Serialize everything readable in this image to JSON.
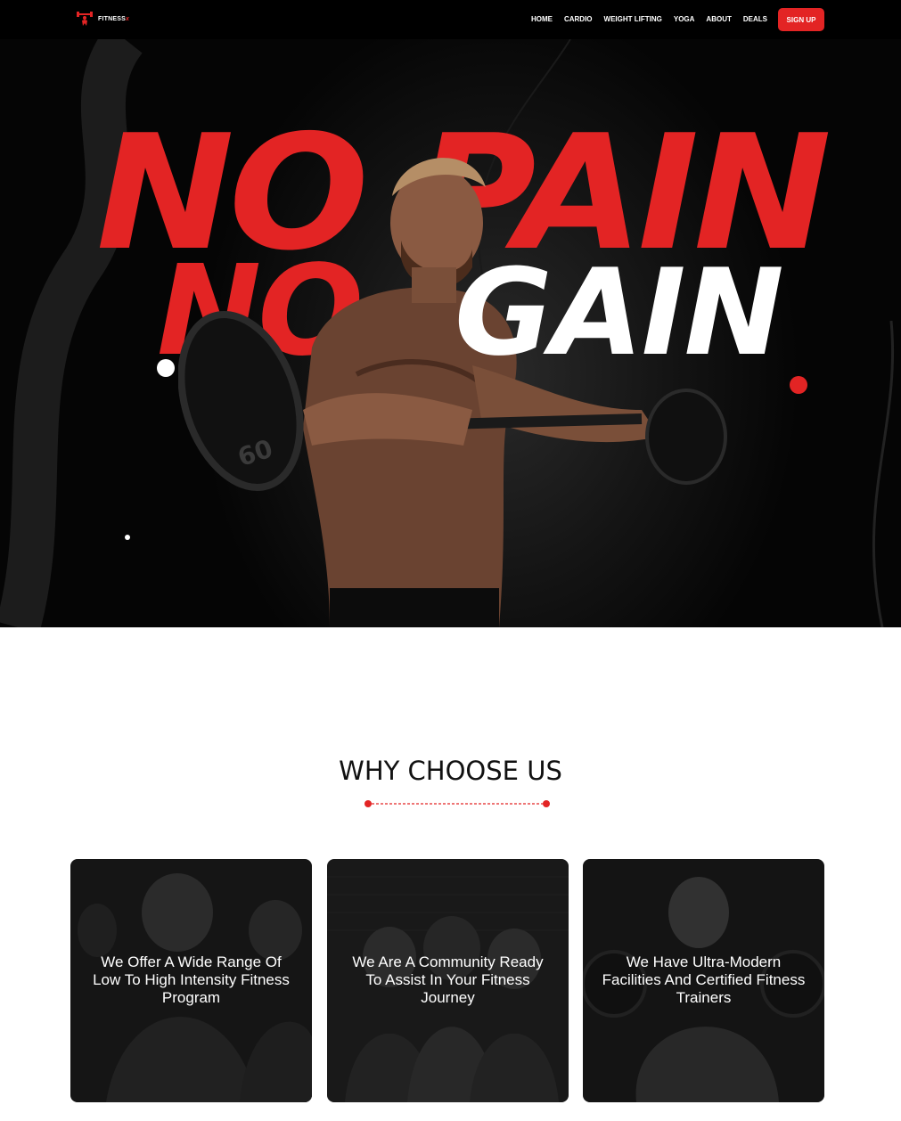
{
  "header": {
    "brand": "FITNESS",
    "brand_mark": "x",
    "nav": [
      "HOME",
      "CARDIO",
      "WEIGHT LIFTING",
      "YOGA",
      "ABOUT",
      "DEALS"
    ],
    "signup_label": "SIGN UP",
    "logo_icon": "dumbbell-lifter-icon"
  },
  "hero": {
    "line1": "NO PAIN",
    "line2a": "NO",
    "line2b": "GAIN",
    "accent": "#e32424"
  },
  "why": {
    "title": "WHY CHOOSE US",
    "cards": [
      {
        "text": "We Offer A Wide Range Of Low To High Intensity Fitness Program"
      },
      {
        "text": "We Are A Community Ready To Assist In Your Fitness Journey"
      },
      {
        "text": "We Have Ultra-Modern Facilities And Certified Fitness Trainers"
      }
    ]
  }
}
